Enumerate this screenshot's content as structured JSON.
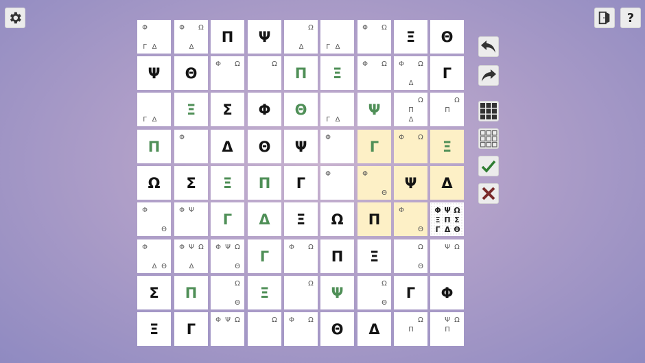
{
  "toolbar": {
    "settings_icon": "gear-icon",
    "exit_icon": "exit-door-icon",
    "help_label": "?"
  },
  "side_buttons": [
    "undo-icon",
    "redo-icon",
    "fill-notes-grid-icon",
    "clear-notes-grid-icon",
    "check-icon",
    "close-icon"
  ],
  "colors": {
    "given": "#141414",
    "entered": "#4f8f57",
    "highlight": "#fdf0c6",
    "check": "#2e7d32",
    "cross": "#7a2b2b"
  },
  "symbols": [
    "Φ",
    "Ψ",
    "Ω",
    "Ξ",
    "Π",
    "Σ",
    "Γ",
    "Δ",
    "Θ"
  ],
  "board": {
    "rows": [
      [
        {
          "notes": [
            "Φ",
            "Γ",
            "Δ"
          ]
        },
        {
          "notes": [
            "Φ",
            "Ω",
            "Δ"
          ]
        },
        {
          "value": "Π",
          "type": "given"
        },
        {
          "value": "Ψ",
          "type": "given"
        },
        {
          "notes": [
            "Ω",
            "Δ"
          ]
        },
        {
          "notes": [
            "Γ",
            "Δ"
          ]
        },
        {
          "notes": [
            "Φ",
            "Ω"
          ]
        },
        {
          "value": "Ξ",
          "type": "given"
        },
        {
          "value": "Θ",
          "type": "given"
        }
      ],
      [
        {
          "value": "Ψ",
          "type": "given"
        },
        {
          "value": "Θ",
          "type": "given"
        },
        {
          "notes": [
            "Φ",
            "Ω"
          ]
        },
        {
          "notes": [
            "Ω"
          ]
        },
        {
          "value": "Π",
          "type": "entered"
        },
        {
          "value": "Ξ",
          "type": "entered"
        },
        {
          "notes": [
            "Φ",
            "Ω"
          ]
        },
        {
          "notes": [
            "Φ",
            "Ω",
            "Δ"
          ]
        },
        {
          "value": "Γ",
          "type": "given"
        }
      ],
      [
        {
          "notes": [
            "Γ",
            "Δ"
          ]
        },
        {
          "value": "Ξ",
          "type": "entered"
        },
        {
          "value": "Σ",
          "type": "given"
        },
        {
          "value": "Φ",
          "type": "given"
        },
        {
          "value": "Θ",
          "type": "entered"
        },
        {
          "notes": [
            "Γ",
            "Δ"
          ]
        },
        {
          "value": "Ψ",
          "type": "entered"
        },
        {
          "notes": [
            "Ω",
            "Π",
            "Δ"
          ]
        },
        {
          "notes": [
            "Ω",
            "Π"
          ]
        }
      ],
      [
        {
          "value": "Π",
          "type": "entered"
        },
        {
          "notes": [
            "Φ"
          ]
        },
        {
          "value": "Δ",
          "type": "given"
        },
        {
          "value": "Θ",
          "type": "given"
        },
        {
          "value": "Ψ",
          "type": "given"
        },
        {
          "notes": [
            "Φ"
          ]
        },
        {
          "value": "Γ",
          "type": "entered",
          "hl": true
        },
        {
          "notes": [
            "Φ",
            "Ω"
          ],
          "hl": true
        },
        {
          "value": "Ξ",
          "type": "entered",
          "hl": true
        }
      ],
      [
        {
          "value": "Ω",
          "type": "given"
        },
        {
          "value": "Σ",
          "type": "given"
        },
        {
          "value": "Ξ",
          "type": "entered"
        },
        {
          "value": "Π",
          "type": "entered"
        },
        {
          "value": "Γ",
          "type": "given"
        },
        {
          "notes": [
            "Φ"
          ]
        },
        {
          "notes": [
            "Φ",
            "Θ"
          ],
          "hl": true
        },
        {
          "value": "Ψ",
          "type": "given",
          "hl": true
        },
        {
          "value": "Δ",
          "type": "given",
          "hl": true
        }
      ],
      [
        {
          "notes": [
            "Φ",
            "Θ"
          ]
        },
        {
          "notes": [
            "Φ",
            "Ψ"
          ]
        },
        {
          "value": "Γ",
          "type": "entered"
        },
        {
          "value": "Δ",
          "type": "entered"
        },
        {
          "value": "Ξ",
          "type": "given"
        },
        {
          "value": "Ω",
          "type": "given"
        },
        {
          "value": "Π",
          "type": "given",
          "hl": true
        },
        {
          "notes": [
            "Φ",
            "Θ"
          ],
          "hl": true
        },
        {
          "dense": [
            "Φ",
            "Ψ",
            "Ω",
            "Ξ",
            "Π",
            "Σ",
            "Γ",
            "Δ",
            "Θ"
          ]
        }
      ],
      [
        {
          "notes": [
            "Φ",
            "Δ",
            "Θ"
          ]
        },
        {
          "notes": [
            "Φ",
            "Ψ",
            "Ω",
            "Δ"
          ]
        },
        {
          "notes": [
            "Φ",
            "Ψ",
            "Ω",
            "Θ"
          ]
        },
        {
          "value": "Γ",
          "type": "entered"
        },
        {
          "notes": [
            "Φ",
            "Ω"
          ]
        },
        {
          "value": "Π",
          "type": "given"
        },
        {
          "value": "Ξ",
          "type": "given"
        },
        {
          "notes": [
            "Ω",
            "Θ"
          ]
        },
        {
          "notes": [
            "Ψ",
            "Ω"
          ]
        }
      ],
      [
        {
          "value": "Σ",
          "type": "given"
        },
        {
          "value": "Π",
          "type": "entered"
        },
        {
          "notes": [
            "Ω",
            "Θ"
          ]
        },
        {
          "value": "Ξ",
          "type": "entered"
        },
        {
          "notes": [
            "Ω"
          ]
        },
        {
          "value": "Ψ",
          "type": "entered"
        },
        {
          "notes": [
            "Ω",
            "Θ"
          ]
        },
        {
          "value": "Γ",
          "type": "given"
        },
        {
          "value": "Φ",
          "type": "given"
        }
      ],
      [
        {
          "value": "Ξ",
          "type": "given"
        },
        {
          "value": "Γ",
          "type": "given"
        },
        {
          "notes": [
            "Φ",
            "Ψ",
            "Ω"
          ]
        },
        {
          "notes": [
            "Ω"
          ]
        },
        {
          "notes": [
            "Φ",
            "Ω"
          ]
        },
        {
          "value": "Θ",
          "type": "given"
        },
        {
          "value": "Δ",
          "type": "given"
        },
        {
          "notes": [
            "Ω",
            "Π"
          ]
        },
        {
          "notes": [
            "Ψ",
            "Ω",
            "Π"
          ]
        }
      ]
    ]
  }
}
